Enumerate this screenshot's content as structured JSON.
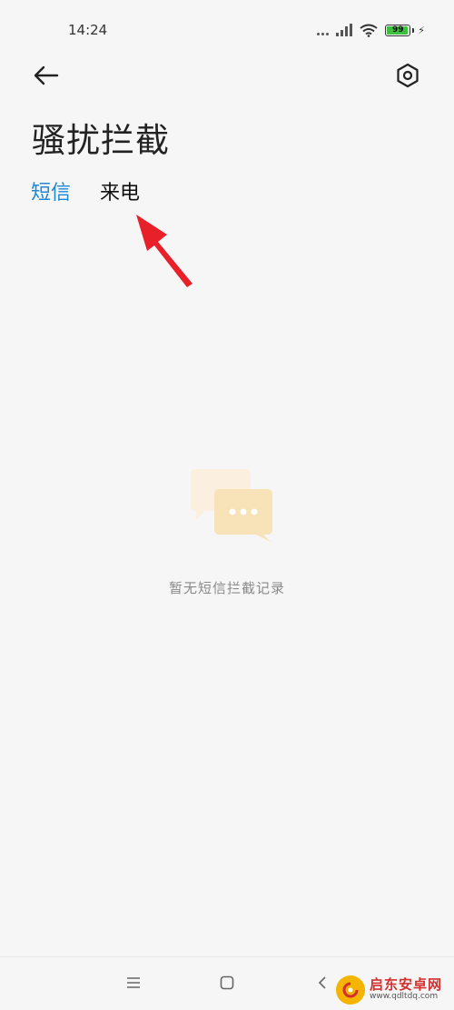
{
  "status_bar": {
    "time": "14:24",
    "battery_level": "99",
    "battery_fraction": 0.99
  },
  "header": {
    "back_icon": "arrow-left-icon",
    "settings_icon": "hexagon-settings-icon",
    "title": "骚扰拦截"
  },
  "tabs": [
    {
      "label": "短信",
      "active": true
    },
    {
      "label": "来电",
      "active": false
    }
  ],
  "empty_state": {
    "icon": "chat-bubbles-icon",
    "message": "暂无短信拦截记录"
  },
  "nav_bar": {
    "menu_icon": "menu-icon",
    "home_icon": "square-home-icon",
    "back_icon": "chevron-left-icon"
  },
  "watermark": {
    "title": "启东安卓网",
    "url": "www.qdltdq.com"
  },
  "colors": {
    "accent": "#1e88d6",
    "background": "#f6f6f6",
    "annotation": "#e8202a",
    "illustration_back": "#fbf0e0",
    "illustration_front": "#f8e3b8"
  }
}
